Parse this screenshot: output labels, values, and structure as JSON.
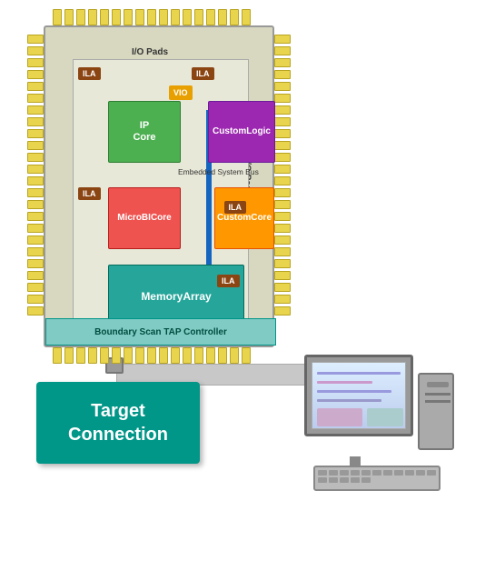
{
  "chip": {
    "io_top": "I/O Pads",
    "io_left": "I/O Pads",
    "io_right": "I/O Pads",
    "ip_core": {
      "line1": "IP",
      "line2": "Core"
    },
    "custom_logic": {
      "line1": "Custom",
      "line2": "Logic"
    },
    "vio": "VIO",
    "ila1": "ILA",
    "ila2": "ILA",
    "ila3": "ILA",
    "ila4": "ILA",
    "bus_label": "Embedded System Bus",
    "microbi": {
      "line1": "MicroBI",
      "line2": "Core"
    },
    "custom_core": {
      "line1": "Custom",
      "line2": "Core"
    },
    "memory_array": {
      "line1": "Memory",
      "line2": "Array"
    },
    "boundary_scan": "Boundary Scan TAP Controller"
  },
  "target_connection": {
    "line1": "Target",
    "line2": "Connection"
  },
  "colors": {
    "pin": "#e8d44d",
    "ip_core": "#4caf50",
    "custom_logic": "#9c27b0",
    "vio": "#e8a000",
    "ila": "#8b4513",
    "microbi": "#ef5350",
    "custom_core": "#ff9800",
    "memory": "#26a69a",
    "boundary": "#80cbc4",
    "target": "#009688",
    "bus": "#1565c0"
  }
}
